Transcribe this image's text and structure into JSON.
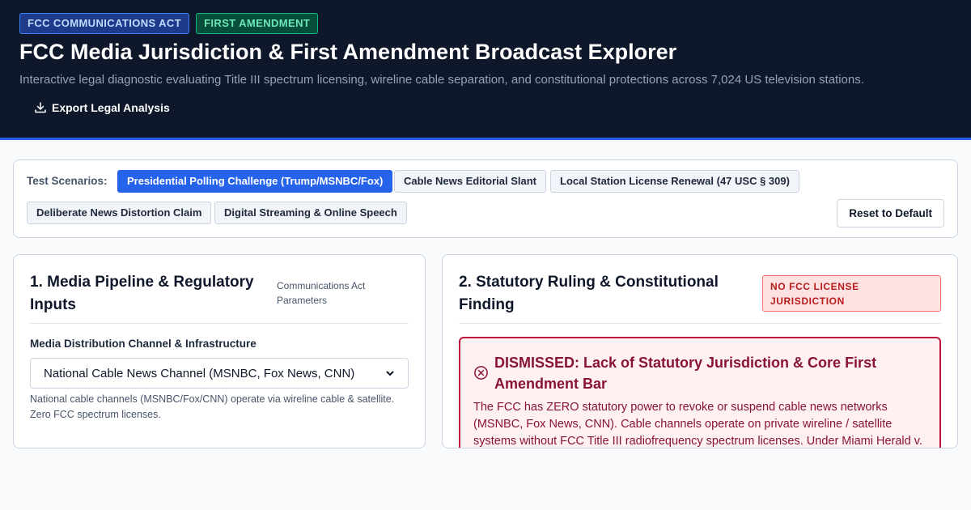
{
  "header": {
    "badges": [
      "FCC COMMUNICATIONS ACT",
      "FIRST AMENDMENT"
    ],
    "title": "FCC Media Jurisdiction & First Amendment Broadcast Explorer",
    "subtitle": "Interactive legal diagnostic evaluating Title III spectrum licensing, wireline cable separation, and constitutional protections across 7,024 US television stations.",
    "export_label": "Export Legal Analysis"
  },
  "scenarios": {
    "label": "Test Scenarios:",
    "items": [
      "Presidential Polling Challenge (Trump/MSNBC/Fox)",
      "Cable News Editorial Slant",
      "Local Station License Renewal (47 USC § 309)",
      "Deliberate News Distortion Claim",
      "Digital Streaming & Online Speech"
    ],
    "active_index": 0,
    "reset_label": "Reset to Default"
  },
  "inputs_panel": {
    "title": "1. Media Pipeline & Regulatory Inputs",
    "subtitle": "Communications Act Parameters",
    "channel_label": "Media Distribution Channel & Infrastructure",
    "channel_value": "National Cable News Channel (MSNBC, Fox News, CNN)",
    "channel_help": "National cable channels (MSNBC/Fox/CNN) operate via wireline cable & satellite. Zero FCC spectrum licenses."
  },
  "ruling_panel": {
    "title": "2. Statutory Ruling & Constitutional Finding",
    "verdict_tag": "NO FCC LICENSE JURISDICTION",
    "ruling_title": "DISMISSED: Lack of Statutory Jurisdiction & Core First Amendment Bar",
    "ruling_body": "The FCC has ZERO statutory power to revoke or suspend cable news networks (MSNBC, Fox News, CNN). Cable channels operate on private wireline / satellite systems without FCC Title III radiofrequency spectrum licenses. Under Miami Herald v."
  },
  "colors": {
    "header_bg": "#0f172a",
    "accent": "#2563eb",
    "danger": "#be123c"
  }
}
